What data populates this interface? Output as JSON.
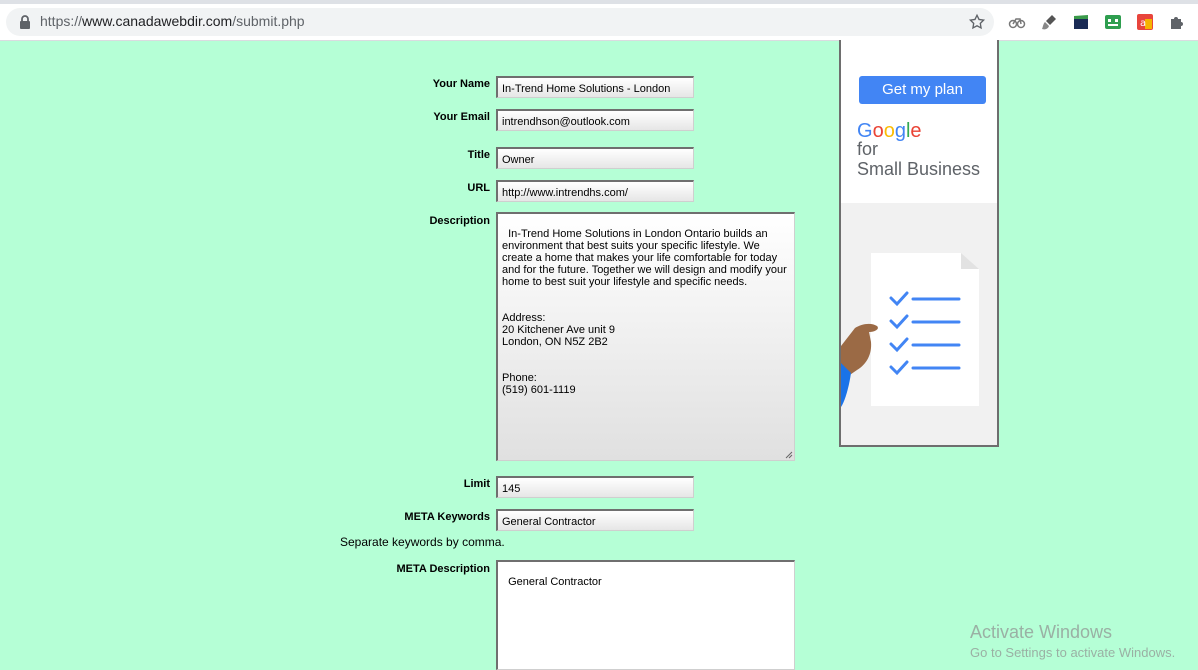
{
  "browser": {
    "url_scheme": "https://",
    "url_host": "www.canadawebdir.com",
    "url_path": "/submit.php"
  },
  "form": {
    "name_label": "Your Name",
    "name_value": "In-Trend Home Solutions - London",
    "email_label": "Your Email",
    "email_value": "intrendhson@outlook.com",
    "title_label": "Title",
    "title_value": "Owner",
    "url_label": "URL",
    "url_value": "http://www.intrendhs.com/",
    "description_label": "Description",
    "description_value": "In-Trend Home Solutions in London Ontario builds an environment that best suits your specific lifestyle. We create a home that makes your life comfortable for today and for the future. Together we will design and modify your home to best suit your lifestyle and specific needs.\n\n\nAddress:\n20 Kitchener Ave unit 9\nLondon, ON N5Z 2B2\n\n\nPhone:\n(519) 601-1119",
    "limit_label": "Limit",
    "limit_value": "145",
    "meta_keywords_label": "META Keywords",
    "meta_keywords_value": "General Contractor",
    "keywords_hint": "Separate keywords by comma.",
    "meta_description_label": "META Description",
    "meta_description_value": "General Contractor"
  },
  "ad": {
    "button_label": "Get my plan",
    "logo_letters": [
      "G",
      "o",
      "o",
      "g",
      "l",
      "e"
    ],
    "logo_colors": [
      "#4285f4",
      "#ea4335",
      "#fbbc05",
      "#4285f4",
      "#34a853",
      "#ea4335"
    ],
    "for_text": "for",
    "small_business_text": "Small Business"
  },
  "watermark": {
    "line1": "Activate Windows",
    "line2": "Go to Settings to activate Windows."
  }
}
